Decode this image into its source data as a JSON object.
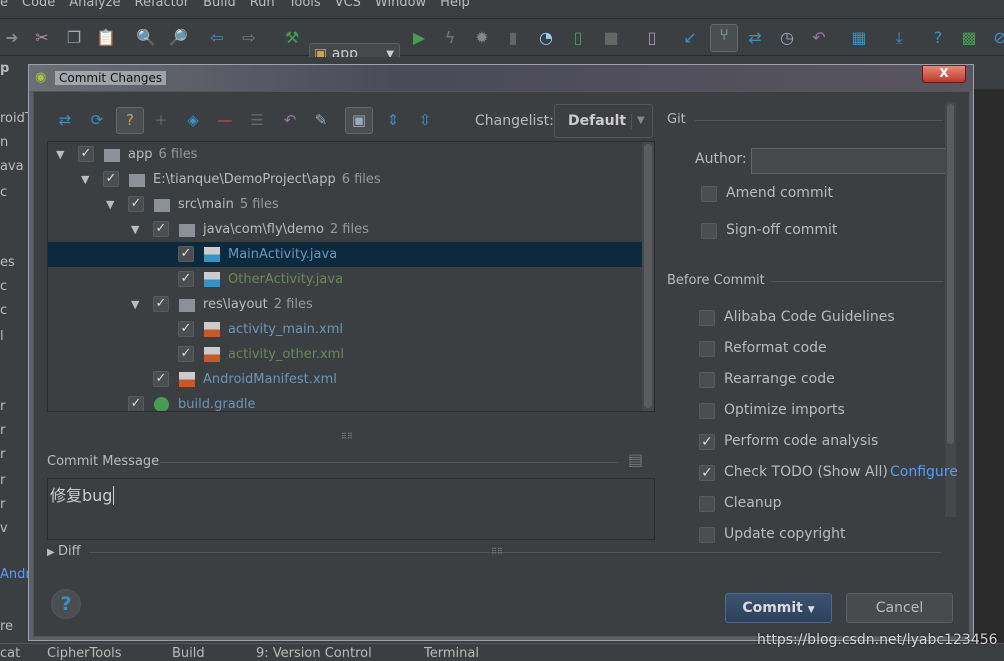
{
  "menu": [
    "e",
    "Code",
    "Analyze",
    "Refactor",
    "Build",
    "Run",
    "Tools",
    "VCS",
    "Window",
    "Help"
  ],
  "toolbar": {
    "run_config": "app"
  },
  "nav": {
    "project": "p",
    "tab_partial": "erAc"
  },
  "left_strip": [
    "roidT",
    "n",
    "ava",
    "c",
    "es",
    "c",
    "c",
    "l",
    "r",
    "r",
    "r",
    "r",
    "r",
    "v",
    "Andr",
    "re"
  ],
  "dialog": {
    "title": "Commit Changes",
    "close_label": "X",
    "changelist_label": "Changelist:",
    "changelist_value": "Default",
    "tree": [
      {
        "name": "app",
        "count": "6 files",
        "level": 0,
        "expand": true,
        "type": "module",
        "color": "default"
      },
      {
        "name": "E:\\tianque\\DemoProject\\app",
        "count": "6 files",
        "level": 1,
        "expand": true,
        "type": "folder",
        "color": "default"
      },
      {
        "name": "src\\main",
        "count": "5 files",
        "level": 2,
        "expand": true,
        "type": "folder",
        "color": "default"
      },
      {
        "name": "java\\com\\fly\\demo",
        "count": "2 files",
        "level": 3,
        "expand": true,
        "type": "folder",
        "color": "default"
      },
      {
        "name": "MainActivity.java",
        "count": "",
        "level": 4,
        "expand": false,
        "type": "java",
        "color": "blue",
        "selected": true
      },
      {
        "name": "OtherActivity.java",
        "count": "",
        "level": 4,
        "expand": false,
        "type": "java",
        "color": "green"
      },
      {
        "name": "res\\layout",
        "count": "2 files",
        "level": 3,
        "expand": true,
        "type": "folder",
        "color": "default"
      },
      {
        "name": "activity_main.xml",
        "count": "",
        "level": 4,
        "expand": false,
        "type": "xml",
        "color": "blue"
      },
      {
        "name": "activity_other.xml",
        "count": "",
        "level": 4,
        "expand": false,
        "type": "xml",
        "color": "green"
      },
      {
        "name": "AndroidManifest.xml",
        "count": "",
        "level": 3,
        "expand": false,
        "type": "xml",
        "color": "blue"
      },
      {
        "name": "build.gradle",
        "count": "",
        "level": 2,
        "expand": false,
        "type": "gradle",
        "color": "blue"
      }
    ],
    "commit_message_label": "Commit Message",
    "commit_message": "修复bug",
    "diff_label": "Diff",
    "git_label": "Git",
    "author_label": "Author:",
    "author_value": "",
    "git_options": [
      {
        "label": "Amend commit",
        "checked": false
      },
      {
        "label": "Sign-off commit",
        "checked": false
      }
    ],
    "before_commit_label": "Before Commit",
    "before_commit": [
      {
        "label": "Alibaba Code Guidelines",
        "checked": false
      },
      {
        "label": "Reformat code",
        "checked": false
      },
      {
        "label": "Rearrange code",
        "checked": false
      },
      {
        "label": "Optimize imports",
        "checked": false
      },
      {
        "label": "Perform code analysis",
        "checked": true
      },
      {
        "label": "Check TODO (Show All)",
        "checked": true,
        "link": "Configure"
      },
      {
        "label": "Cleanup",
        "checked": false
      },
      {
        "label": "Update copyright",
        "checked": false
      }
    ],
    "commit_button": "Commit",
    "cancel_button": "Cancel",
    "help_label": "?"
  },
  "statusbar": [
    "cat",
    "CipherTools",
    "Build",
    "9: Version Control",
    "Terminal"
  ],
  "watermark": "https://blog.csdn.net/lyabc123456",
  "colors": {
    "bg": "#3c3f41",
    "selection": "#0d293e",
    "link": "#589df6",
    "blue_file": "#6897bb",
    "green_file": "#6a8759"
  }
}
